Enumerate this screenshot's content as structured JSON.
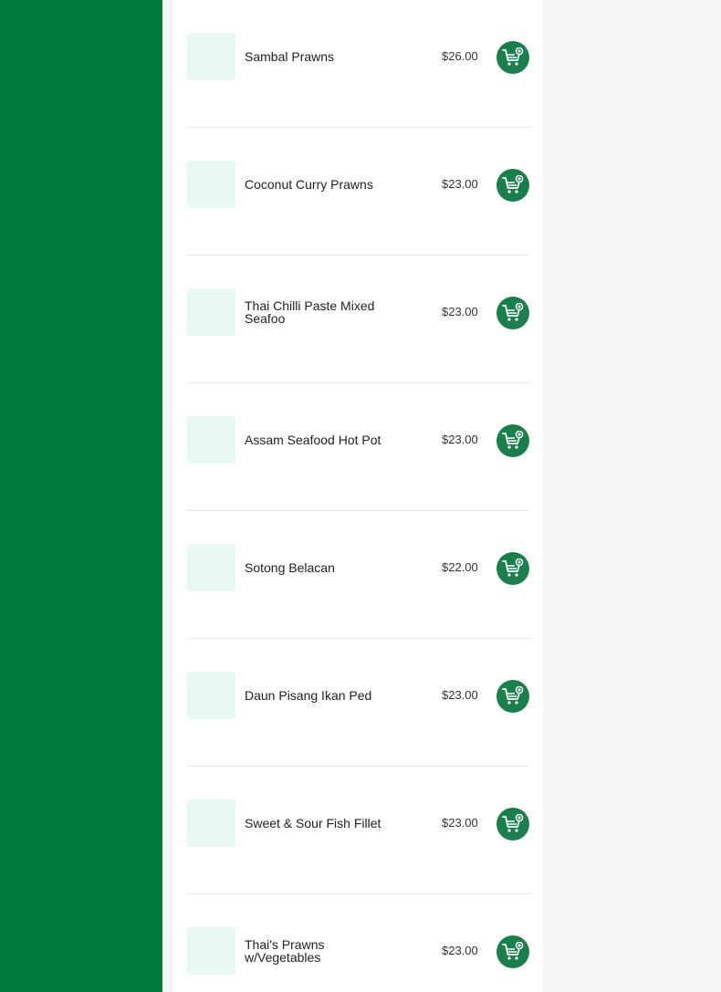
{
  "colors": {
    "sidebar": "#007a3d",
    "add_button": "#1a7f4b",
    "thumb_placeholder": "#e8f7f2"
  },
  "menu": {
    "items": [
      {
        "name": "Sambal Prawns",
        "price": "$26.00",
        "icon": "cart-plus-icon"
      },
      {
        "name": "Coconut Curry Prawns",
        "price": "$23.00",
        "icon": "cart-plus-icon"
      },
      {
        "name": "Thai Chilli Paste Mixed Seafoo",
        "price": "$23.00",
        "icon": "cart-plus-icon"
      },
      {
        "name": "Assam Seafood Hot Pot",
        "price": "$23.00",
        "icon": "cart-plus-icon"
      },
      {
        "name": "Sotong Belacan",
        "price": "$22.00",
        "icon": "cart-plus-icon"
      },
      {
        "name": "Daun Pisang Ikan Ped",
        "price": "$23.00",
        "icon": "cart-plus-icon"
      },
      {
        "name": "Sweet & Sour Fish Fillet",
        "price": "$23.00",
        "icon": "cart-plus-icon"
      },
      {
        "name": "Thai's Prawns w/Vegetables",
        "price": "$23.00",
        "icon": "cart-plus-icon"
      }
    ]
  }
}
